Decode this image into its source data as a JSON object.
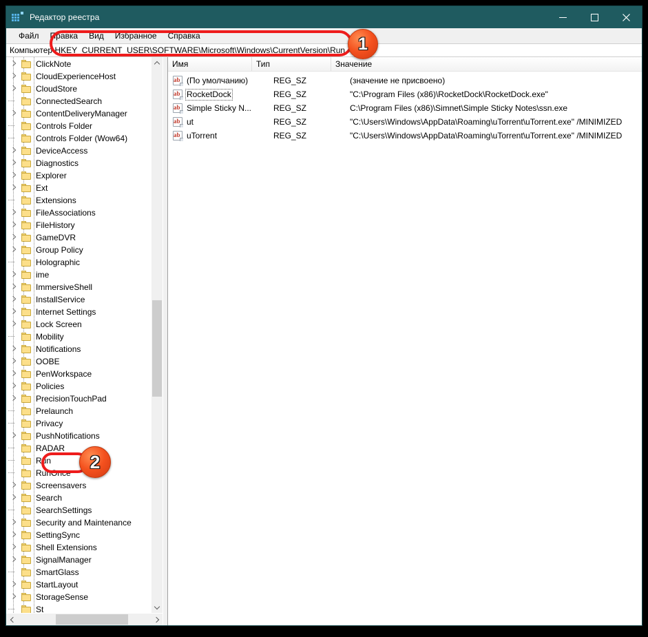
{
  "window": {
    "title": "Редактор реестра",
    "icon": "registry-editor-icon",
    "controls": {
      "minimize": "—",
      "maximize": "▢",
      "close": "✕"
    }
  },
  "menubar": {
    "items": [
      {
        "label": "Файл"
      },
      {
        "label": "Правка"
      },
      {
        "label": "Вид"
      },
      {
        "label": "Избранное"
      },
      {
        "label": "Справка"
      }
    ]
  },
  "address": {
    "value": "Компьютер\\HKEY_CURRENT_USER\\SOFTWARE\\Microsoft\\Windows\\CurrentVersion\\Run"
  },
  "tree": {
    "items": [
      {
        "label": "ClickNote",
        "expandable": true
      },
      {
        "label": "CloudExperienceHost",
        "expandable": true
      },
      {
        "label": "CloudStore",
        "expandable": true
      },
      {
        "label": "ConnectedSearch",
        "expandable": false
      },
      {
        "label": "ContentDeliveryManager",
        "expandable": true
      },
      {
        "label": "Controls Folder",
        "expandable": false
      },
      {
        "label": "Controls Folder (Wow64)",
        "expandable": false
      },
      {
        "label": "DeviceAccess",
        "expandable": true
      },
      {
        "label": "Diagnostics",
        "expandable": true
      },
      {
        "label": "Explorer",
        "expandable": true
      },
      {
        "label": "Ext",
        "expandable": true
      },
      {
        "label": "Extensions",
        "expandable": false
      },
      {
        "label": "FileAssociations",
        "expandable": true
      },
      {
        "label": "FileHistory",
        "expandable": true
      },
      {
        "label": "GameDVR",
        "expandable": true
      },
      {
        "label": "Group Policy",
        "expandable": true
      },
      {
        "label": "Holographic",
        "expandable": false
      },
      {
        "label": "ime",
        "expandable": true
      },
      {
        "label": "ImmersiveShell",
        "expandable": true
      },
      {
        "label": "InstallService",
        "expandable": true
      },
      {
        "label": "Internet Settings",
        "expandable": true
      },
      {
        "label": "Lock Screen",
        "expandable": true
      },
      {
        "label": "Mobility",
        "expandable": false
      },
      {
        "label": "Notifications",
        "expandable": true
      },
      {
        "label": "OOBE",
        "expandable": true
      },
      {
        "label": "PenWorkspace",
        "expandable": true
      },
      {
        "label": "Policies",
        "expandable": true
      },
      {
        "label": "PrecisionTouchPad",
        "expandable": true
      },
      {
        "label": "Prelaunch",
        "expandable": false
      },
      {
        "label": "Privacy",
        "expandable": false
      },
      {
        "label": "PushNotifications",
        "expandable": true
      },
      {
        "label": "RADAR",
        "expandable": false
      },
      {
        "label": "Run",
        "expandable": false
      },
      {
        "label": "RunOnce",
        "expandable": false
      },
      {
        "label": "Screensavers",
        "expandable": true
      },
      {
        "label": "Search",
        "expandable": true
      },
      {
        "label": "SearchSettings",
        "expandable": false
      },
      {
        "label": "Security and Maintenance",
        "expandable": true
      },
      {
        "label": "SettingSync",
        "expandable": true
      },
      {
        "label": "Shell Extensions",
        "expandable": true
      },
      {
        "label": "SignalManager",
        "expandable": true
      },
      {
        "label": "SmartGlass",
        "expandable": false
      },
      {
        "label": "StartLayout",
        "expandable": true
      },
      {
        "label": "StorageSense",
        "expandable": true
      },
      {
        "label": "St",
        "expandable": false
      }
    ]
  },
  "list": {
    "columns": [
      {
        "label": "Имя"
      },
      {
        "label": "Тип"
      },
      {
        "label": "Значение"
      }
    ],
    "rows": [
      {
        "name": "(По умолчанию)",
        "type": "REG_SZ",
        "value": "(значение не присвоено)",
        "icon": "string-value-icon",
        "focused": false
      },
      {
        "name": "RocketDock",
        "type": "REG_SZ",
        "value": "\"C:\\Program Files (x86)\\RocketDock\\RocketDock.exe\"",
        "icon": "string-value-icon",
        "focused": true
      },
      {
        "name": "Simple Sticky N...",
        "type": "REG_SZ",
        "value": "C:\\Program Files (x86)\\Simnet\\Simple Sticky Notes\\ssn.exe",
        "icon": "string-value-icon",
        "focused": false
      },
      {
        "name": "ut",
        "type": "REG_SZ",
        "value": "\"C:\\Users\\Windows\\AppData\\Roaming\\uTorrent\\uTorrent.exe\"  /MINIMIZED",
        "icon": "string-value-icon",
        "focused": false
      },
      {
        "name": "uTorrent",
        "type": "REG_SZ",
        "value": "\"C:\\Users\\Windows\\AppData\\Roaming\\uTorrent\\uTorrent.exe\"  /MINIMIZED",
        "icon": "string-value-icon",
        "focused": false
      }
    ]
  },
  "annotations": {
    "step1": {
      "label": "1"
    },
    "step2": {
      "label": "2"
    }
  },
  "colors": {
    "titlebar": "#1f5b60",
    "annotation_ring": "#ee1c1c",
    "badge": "#f4511e",
    "folder": "#fcdf8a"
  }
}
